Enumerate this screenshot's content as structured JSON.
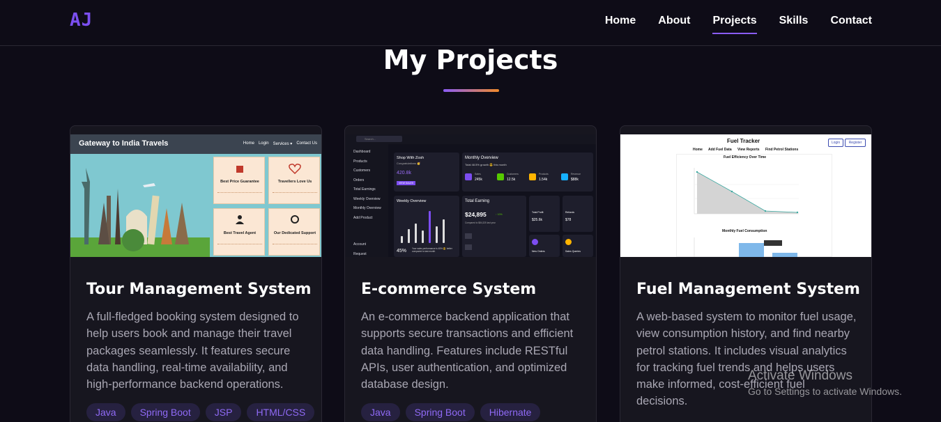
{
  "nav": {
    "logo": "AJ",
    "links": [
      "Home",
      "About",
      "Projects",
      "Skills",
      "Contact"
    ],
    "active": "Projects"
  },
  "section": {
    "title": "My Projects"
  },
  "colors": {
    "accent": "#8a5cf6",
    "accent_orange": "#f08a2a",
    "background": "#0e0c17",
    "card": "#17161f"
  },
  "projects": [
    {
      "title": "Tour Management System",
      "description": "A full-fledged booking system designed to help users book and manage their travel packages seamlessly. It features secure data handling, real-time availability, and high-performance backend operations.",
      "tags": [
        "Java",
        "Spring Boot",
        "JSP",
        "HTML/CSS"
      ],
      "thumbnail": {
        "site_title": "Gateway to India Travels",
        "menu": [
          "Home",
          "Login",
          "Services ▾",
          "Contact Us"
        ],
        "boxes": [
          "Best Price Guarantee",
          "Travellers Love Us",
          "Best Travel Agent",
          "Our Dedicated Support"
        ]
      }
    },
    {
      "title": "E-commerce System",
      "description": "An e-commerce backend application that supports secure transactions and efficient data handling. Features include RESTful APIs, user authentication, and optimized database design.",
      "tags": [
        "Java",
        "Spring Boot",
        "Hibernate"
      ],
      "thumbnail": {
        "search": "Search...",
        "sidebar": [
          "Dashboard",
          "Products",
          "Customers",
          "Orders",
          "Total Earnings",
          "Weekly Overview",
          "Monthly Overview",
          "Add Product",
          "Account",
          "Request"
        ],
        "shop_title": "Shop With Zosh",
        "shop_sub": "Congratulations 🥳",
        "shop_value": "420.8k",
        "shop_button": "VIEW SALES",
        "monthly_title": "Monthly Overview",
        "monthly_sub": "Total 48.5% growth 😎 this month",
        "stats": [
          {
            "label": "Sales",
            "value": "245k"
          },
          {
            "label": "Customers",
            "value": "12.5k"
          },
          {
            "label": "Products",
            "value": "1.54k"
          },
          {
            "label": "Revenue",
            "value": "$88k"
          }
        ],
        "weekly_title": "Weekly Overview",
        "weekly_pct": "45%",
        "weekly_note": "Your sales performance is 45% 😎 better compared to last month",
        "earning_title": "Total Earning",
        "earning_value": "$24,895",
        "earning_change": "↑ 10%",
        "earning_note": "Compared to $84,325 last year",
        "total_profit": "Total Profit",
        "total_profit_value": "$25.6k",
        "refunds": "Refunds",
        "refunds_value": "$78",
        "new_orders": "New Orders",
        "sales_queries": "Sales Queries"
      }
    },
    {
      "title": "Fuel Management System",
      "description": "A web-based system to monitor fuel usage, view consumption history, and find nearby petrol stations. It includes visual analytics for tracking fuel trends and helps users make informed, cost-efficient fuel decisions.",
      "tags": [],
      "thumbnail": {
        "site_title": "Fuel Tracker",
        "buttons": [
          "Login",
          "Register"
        ],
        "menu": [
          "Home",
          "Add Fuel Data",
          "View Reports",
          "Find Petrol Stations"
        ],
        "chart1_title": "Fuel Efficiency Over Time",
        "chart2_title": "Monthly Fuel Consumption"
      }
    }
  ],
  "watermark": {
    "line1": "Activate Windows",
    "line2": "Go to Settings to activate Windows."
  }
}
